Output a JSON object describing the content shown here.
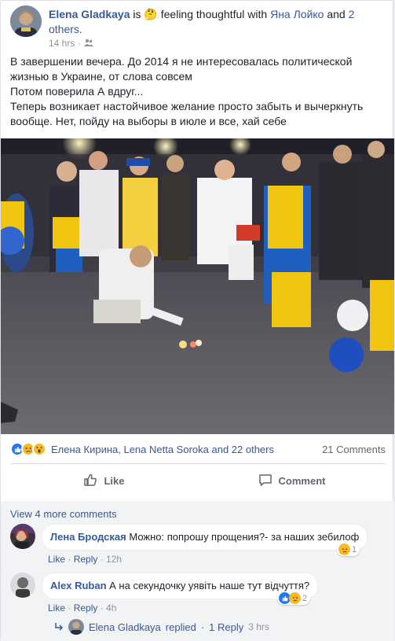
{
  "post": {
    "author": "Elena Gladkaya",
    "feeling_is": "is",
    "feeling_text": "feeling thoughtful with",
    "tagged": "Яна Лойко",
    "and": "and",
    "others": "2 others.",
    "time": "14 hrs",
    "privacy_icon": "friends-icon",
    "text_lines": [
      "В завершении вечера. До 2014 я не интересовалась политической",
      "жизнью в Украине, от слова совсем",
      "Потом поверила А вдруг...",
      "Теперь возникает настойчивое желание просто забыть и вычеркнуть",
      "вообще. Нет, пойду на выборы в июле и все, хай себе"
    ]
  },
  "reactions": {
    "icons": [
      "like-icon",
      "sad-icon",
      "wow-icon"
    ],
    "summary": "Елена Кирина, Lena Netta Soroka and 22 others",
    "comments_count": "21 Comments"
  },
  "actions": {
    "like": "Like",
    "comment": "Comment"
  },
  "comments_section": {
    "view_more": "View 4 more comments",
    "comments": [
      {
        "author": "Лена Бродская",
        "text": "Можно: попрошу прощения?- за наших зебилоф",
        "like": "Like",
        "reply": "Reply",
        "time": "12h",
        "reaction_count": "1"
      },
      {
        "author": "Alex Ruban",
        "text": "А на секундочку уявіть наше тут відчуття?",
        "like": "Like",
        "reply": "Reply",
        "time": "4h",
        "reaction_count": "2"
      }
    ],
    "reply_summary": {
      "name": "Elena Gladkaya",
      "replied": "replied",
      "count": "1 Reply",
      "time": "3 hrs"
    }
  },
  "colors": {
    "link": "#385898",
    "muted": "#90949c",
    "like_blue": "#2078f4",
    "sad_yellow": "#f7b928"
  }
}
